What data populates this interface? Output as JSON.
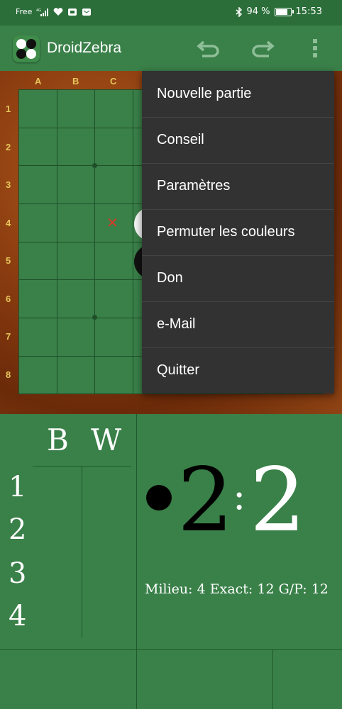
{
  "status_bar": {
    "carrier": "Free",
    "network": "4G",
    "battery": "94 %",
    "battery_level": 0.94,
    "time": "15:53"
  },
  "app_bar": {
    "title": "DroidZebra",
    "icons": [
      "app-icon",
      "undo-icon",
      "redo-icon",
      "more-vert-icon"
    ]
  },
  "board": {
    "columns": [
      "A",
      "B",
      "C"
    ],
    "rows": [
      "1",
      "2",
      "3",
      "4",
      "5",
      "6",
      "7",
      "8"
    ],
    "hint_mark": "✕"
  },
  "menu": {
    "items": [
      "Nouvelle partie",
      "Conseil",
      "Paramètres",
      "Permuter les couleurs",
      "Don",
      "e-Mail",
      "Quitter"
    ]
  },
  "score": {
    "black_header": "B",
    "white_header": "W",
    "move_numbers": [
      "1",
      "2",
      "3",
      "4"
    ],
    "black_score": "2",
    "separator": ":",
    "white_score": "2",
    "stats": "Milieu: 4 Exact: 12 G/P: 12"
  },
  "colors": {
    "board_green": "#3a8049",
    "status_green": "#2b6e3a",
    "menu_bg": "#323232",
    "label_gold": "#e5c55a"
  }
}
